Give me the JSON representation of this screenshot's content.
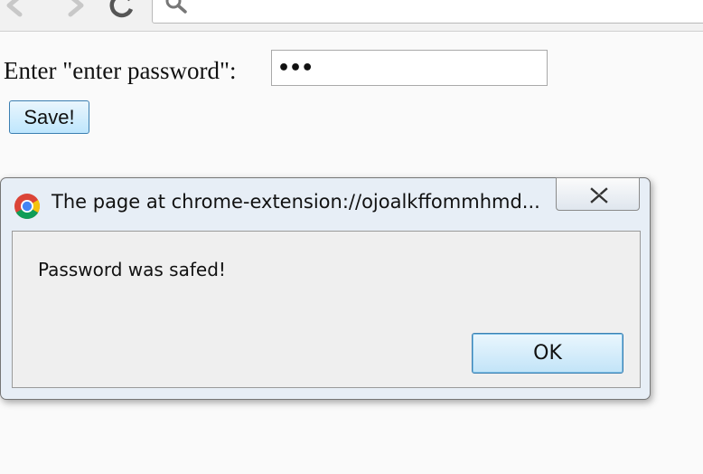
{
  "toolbar": {
    "back_icon": "back-arrow-icon",
    "forward_icon": "forward-arrow-icon",
    "reload_icon": "reload-icon",
    "omnibox_icon": "search-icon"
  },
  "form": {
    "label": "Enter \"enter password\":",
    "password_value": "•••",
    "save_label": "Save!"
  },
  "dialog": {
    "icon": "chrome-icon",
    "title": "The page at chrome-extension://ojoalkffommhmd...",
    "close_icon": "close-icon",
    "message": "Password was safed!",
    "ok_label": "OK"
  },
  "colors": {
    "button_border": "#3c7fb1",
    "button_fill": "#bee6fd",
    "dialog_frame": "#e7eef6",
    "chrome_red": "#db4437",
    "chrome_yellow": "#f4c20d",
    "chrome_green": "#0f9d58",
    "chrome_blue": "#4285f4"
  }
}
